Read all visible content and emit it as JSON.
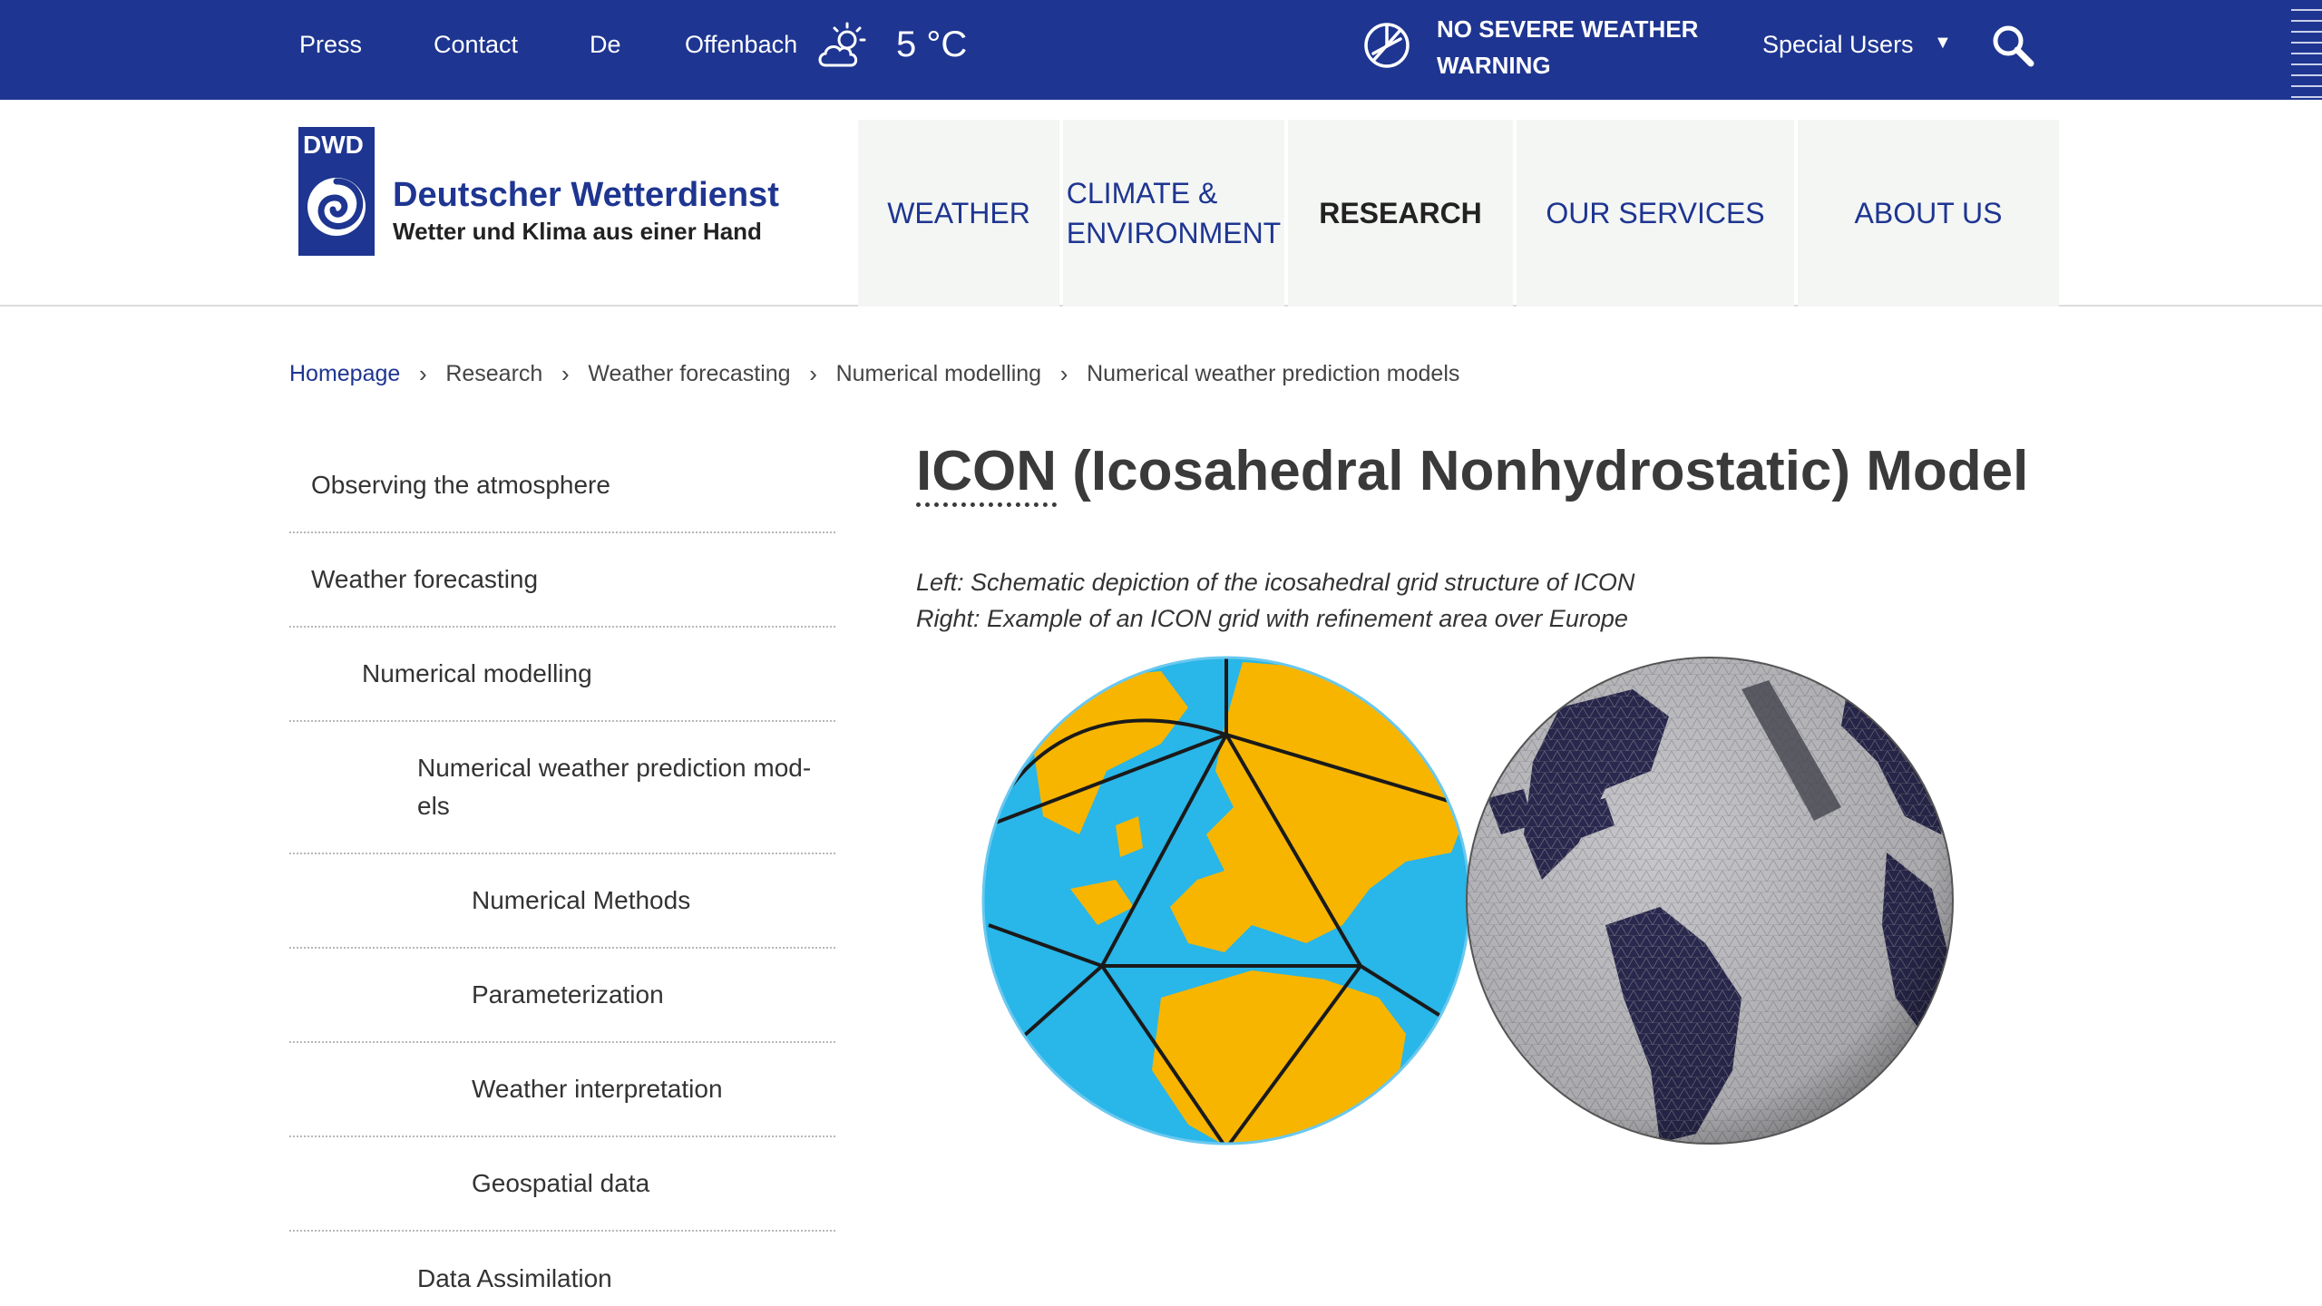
{
  "topbar": {
    "press": "Press",
    "contact": "Contact",
    "language": "De",
    "location": "Offenbach",
    "weather_icon": "cloud-sun-icon",
    "temperature": "5 °C",
    "warning_icon": "no-warning-icon",
    "warning_line1": "NO SEVERE WEATHER",
    "warning_line2": "WARNING",
    "special_users": "Special Users",
    "caret": "▼",
    "search_icon": "search-icon",
    "colors": {
      "background": "#1e3591",
      "text": "#ffffff"
    }
  },
  "logo": {
    "badge": "DWD",
    "name": "Deutscher Wetterdienst",
    "slogan": "Wetter und Klima aus einer Hand"
  },
  "nav": {
    "weather": "WEATHER",
    "climate_line1": "CLIMATE &",
    "climate_line2": "ENVIRONMENT",
    "research": "RESEARCH",
    "services": "OUR SERVICES",
    "about": "ABOUT US",
    "active": "RESEARCH"
  },
  "breadcrumb": {
    "home": "Homepage",
    "research": "Research",
    "forecasting": "Weather forecasting",
    "modelling": "Numerical modelling",
    "nwp": "Numerical weather prediction models",
    "separator": "›"
  },
  "sidebar": {
    "items": [
      {
        "label": "Observing the atmosphere"
      },
      {
        "label": "Weather forecasting"
      },
      {
        "label": "Numerical modelling"
      },
      {
        "label": "Numerical weather prediction mod-",
        "label2": "els"
      },
      {
        "label": "Numerical Methods"
      },
      {
        "label": "Parameterization"
      },
      {
        "label": "Weather interpretation"
      },
      {
        "label": "Geospatial data"
      },
      {
        "label": "Data Assimilation"
      }
    ]
  },
  "main": {
    "title_abbr": "ICON",
    "title_rest": " (Icosahedral Nonhydrostatic) Model",
    "caption_line1": "Left: Schematic depiction of the icosahedral grid structure of ICON",
    "caption_line2": "Right: Example of an ICON grid with refinement area over Europe"
  },
  "colors": {
    "brand_blue": "#1e3591",
    "globe_ocean": "#29b6e8",
    "globe_land": "#f7b500",
    "grid_globe_surface": "#c8c8cc",
    "grid_globe_land": "#2c2a52"
  }
}
